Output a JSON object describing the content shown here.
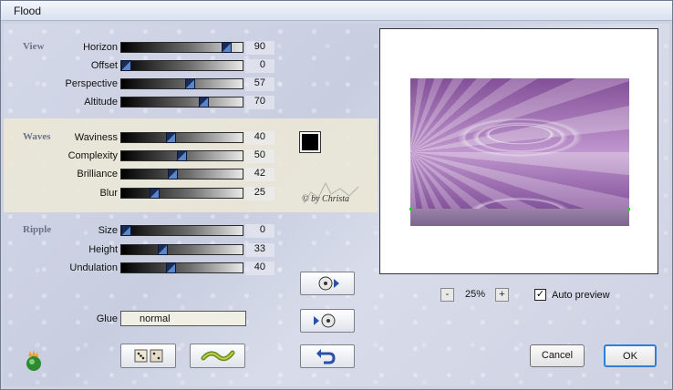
{
  "window": {
    "title": "Flood"
  },
  "groups": {
    "view": "View",
    "waves": "Waves",
    "ripple": "Ripple"
  },
  "sliders": [
    {
      "label": "Horizon",
      "value": "90",
      "level": 0.9
    },
    {
      "label": "Offset",
      "value": "0",
      "level": 0.0
    },
    {
      "label": "Perspective",
      "value": "57",
      "level": 0.57
    },
    {
      "label": "Altitude",
      "value": "70",
      "level": 0.7
    },
    {
      "label": "Waviness",
      "value": "40",
      "level": 0.4
    },
    {
      "label": "Complexity",
      "value": "50",
      "level": 0.5
    },
    {
      "label": "Brilliance",
      "value": "42",
      "level": 0.42
    },
    {
      "label": "Blur",
      "value": "25",
      "level": 0.25
    },
    {
      "label": "Size",
      "value": "0",
      "level": 0.0
    },
    {
      "label": "Height",
      "value": "33",
      "level": 0.33
    },
    {
      "label": "Undulation",
      "value": "40",
      "level": 0.4
    }
  ],
  "glue": {
    "label": "Glue",
    "value": "normal"
  },
  "watermark": "© by Christa",
  "color_swatch": "#000000",
  "preview": {
    "zoom_minus": "-",
    "zoom": "25%",
    "zoom_plus": "+",
    "auto_preview_label": "Auto preview",
    "auto_preview_checked": "✓"
  },
  "buttons": {
    "cancel": "Cancel",
    "ok": "OK"
  },
  "icons": {
    "app": "flood-plugin-icon",
    "randomize": "dice-icon",
    "reset": "wave-icon",
    "load": "load-preset-icon",
    "save": "save-preset-icon",
    "undo": "undo-icon"
  },
  "colors": {
    "accent": "#6a7388",
    "ok_border": "#2f7fd8"
  }
}
